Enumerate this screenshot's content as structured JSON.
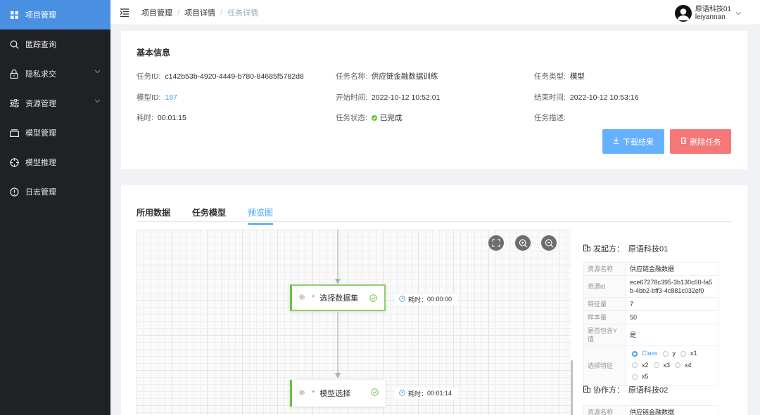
{
  "sidebar": {
    "items": [
      {
        "label": "项目管理",
        "icon": "grid-icon"
      },
      {
        "label": "匿踪查询",
        "icon": "search-icon"
      },
      {
        "label": "隐私求交",
        "icon": "lock-icon"
      },
      {
        "label": "资源管理",
        "icon": "sliders-icon"
      },
      {
        "label": "模型管理",
        "icon": "box-icon"
      },
      {
        "label": "模型推理",
        "icon": "crosshair-icon"
      },
      {
        "label": "日志管理",
        "icon": "alert-circle-icon"
      }
    ]
  },
  "header": {
    "breadcrumbs": [
      "项目管理",
      "项目详情",
      "任务详情"
    ],
    "user_org": "原语科技01",
    "user_name": "leiyannan"
  },
  "basic": {
    "title": "基本信息",
    "task_id_label": "任务ID:",
    "task_id": "c142b53b-4920-4449-b780-84685f5782d8",
    "task_name_label": "任务名称:",
    "task_name": "供应链金融数据训练",
    "task_type_label": "任务类型:",
    "task_type": "模型",
    "model_id_label": "模型ID:",
    "model_id": "187",
    "start_label": "开始时间:",
    "start": "2022-10-12 10:52:01",
    "end_label": "结束时间:",
    "end": "2022-10-12 10:53:16",
    "duration_label": "耗时:",
    "duration": "00:01:15",
    "status_label": "任务状态:",
    "status": "已完成",
    "desc_label": "任务描述:",
    "download_label": "下载结果",
    "delete_label": "删除任务"
  },
  "tabs": [
    "所用数据",
    "任务模型",
    "预览图"
  ],
  "canvas": {
    "nodes": [
      {
        "label": "选择数据集",
        "time_label": "耗时：",
        "time": "00:00:00"
      },
      {
        "label": "模型选择",
        "time_label": "耗时：",
        "time": "00:01:14"
      }
    ]
  },
  "initiator": {
    "label": "发起方：",
    "name": "原语科技01",
    "rows": {
      "res_name_k": "资源名称",
      "res_name_v": "供应链金融数据",
      "res_id_k": "资源id",
      "res_id_v": "ece67278c395-3b130c60-fa5b-4bb2-bff3-4c881c032ef0",
      "features_k": "特征量",
      "features_v": "7",
      "samples_k": "样本量",
      "samples_v": "50",
      "hasy_k": "是否包含Y值",
      "hasy_v": "是",
      "select_k": "选择特征"
    },
    "features": [
      "Class",
      "y",
      "x1",
      "x2",
      "x3",
      "x4",
      "x5"
    ],
    "selected_feature": "Class"
  },
  "collaborator": {
    "label": "协作方：",
    "name": "原语科技02",
    "res_name_k": "资源名称",
    "res_name_v": "供应链金融数据"
  },
  "colors": {
    "primary": "#409eff",
    "success": "#67c23a",
    "danger": "#f56c6c",
    "sidebar_bg": "#1f2125",
    "sidebar_active": "#4a90e2"
  }
}
